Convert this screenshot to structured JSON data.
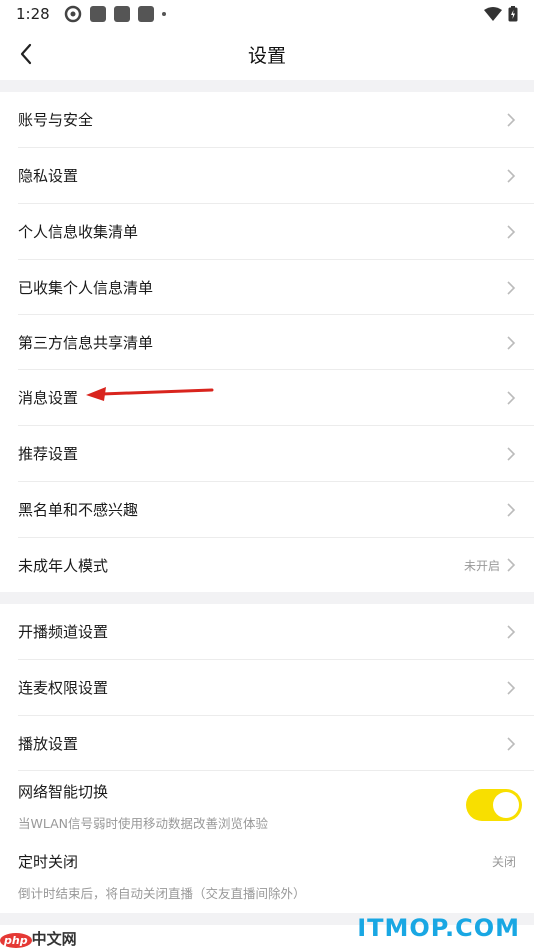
{
  "status_bar": {
    "time": "1:28"
  },
  "nav": {
    "title": "设置"
  },
  "group1": [
    {
      "label": "账号与安全"
    },
    {
      "label": "隐私设置"
    },
    {
      "label": "个人信息收集清单"
    },
    {
      "label": "已收集个人信息清单"
    },
    {
      "label": "第三方信息共享清单"
    },
    {
      "label": "消息设置"
    },
    {
      "label": "推荐设置"
    },
    {
      "label": "黑名单和不感兴趣"
    },
    {
      "label": "未成年人模式",
      "value": "未开启"
    }
  ],
  "group2": [
    {
      "label": "开播频道设置"
    },
    {
      "label": "连麦权限设置"
    },
    {
      "label": "播放设置"
    }
  ],
  "network": {
    "label": "网络智能切换",
    "description": "当WLAN信号弱时使用移动数据改善浏览体验",
    "enabled": true
  },
  "timer": {
    "label": "定时关闭",
    "value": "关闭",
    "description": "倒计时结束后，将自动关闭直播（交友直播间除外）"
  },
  "watermark": {
    "left_badge": "php",
    "left_text": "中文网",
    "right_text": "ITMOP.COM"
  },
  "colors": {
    "toggle_on": "#f8df00",
    "arrow": "#d9241d",
    "watermark": "#19a7e3"
  }
}
